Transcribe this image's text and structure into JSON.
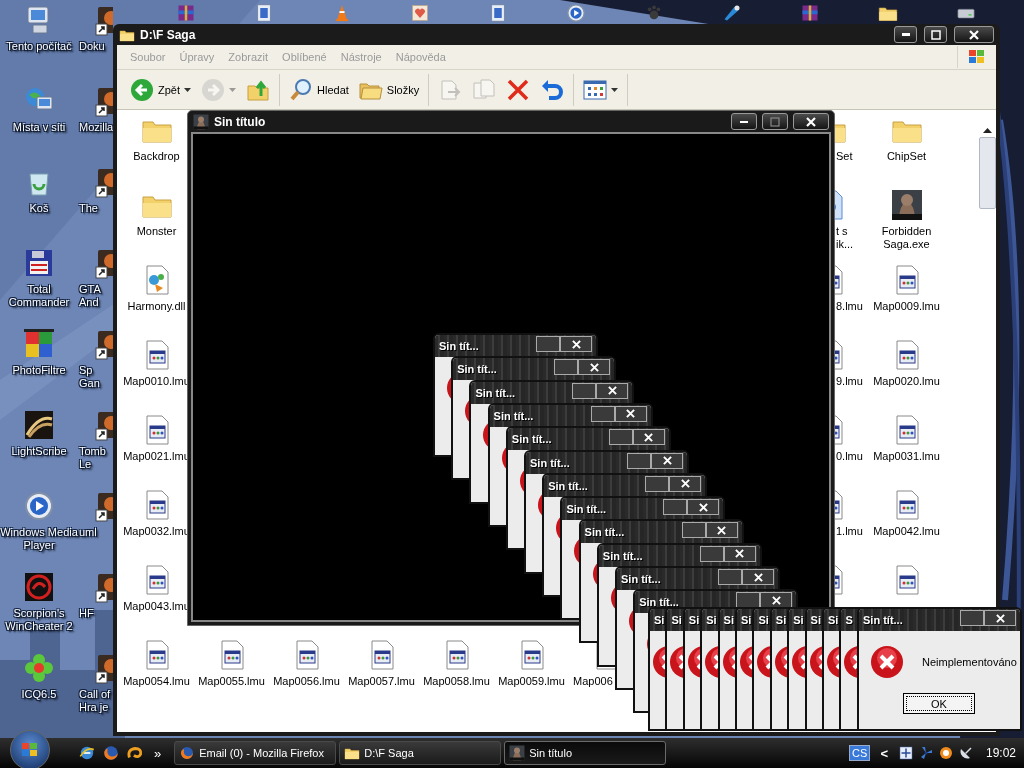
{
  "desktop_icons": [
    {
      "kind": "computer",
      "lines": [
        "Tento počítač"
      ]
    },
    {
      "kind": "network",
      "lines": [
        "Místa v síti"
      ]
    },
    {
      "kind": "trash",
      "lines": [
        "Koš"
      ]
    },
    {
      "kind": "floppy",
      "lines": [
        "Total",
        "Commander"
      ]
    },
    {
      "kind": "palette",
      "lines": [
        "PhotoFiltre"
      ]
    },
    {
      "kind": "disc",
      "lines": [
        "LightScribe"
      ]
    },
    {
      "kind": "media",
      "lines": [
        "Windows Media",
        "Player"
      ]
    },
    {
      "kind": "scorpion",
      "lines": [
        "Scorpion's",
        "WinCheater 2"
      ]
    },
    {
      "kind": "flower",
      "lines": [
        "ICQ6.5"
      ]
    }
  ],
  "desktop_icons_2": [
    {
      "kind": "app",
      "lines": [
        "Doku"
      ]
    },
    {
      "kind": "app",
      "lines": [
        "Mozilla"
      ]
    },
    {
      "kind": "app",
      "lines": [
        "The"
      ]
    },
    {
      "kind": "app",
      "lines": [
        "GTA",
        "And"
      ]
    },
    {
      "kind": "app",
      "lines": [
        "Sp",
        "Gan"
      ]
    },
    {
      "kind": "app",
      "lines": [
        "Tomb",
        "Le"
      ]
    },
    {
      "kind": "app",
      "lines": [
        "uml"
      ]
    },
    {
      "kind": "app",
      "lines": [
        "HF"
      ]
    },
    {
      "kind": "app",
      "lines": [
        "Call of",
        "Hra je"
      ]
    }
  ],
  "top_icons": [
    {
      "kind": "archive"
    },
    {
      "kind": "film"
    },
    {
      "kind": "cone"
    },
    {
      "kind": "heart"
    },
    {
      "kind": "film"
    },
    {
      "kind": "media"
    },
    {
      "kind": "paw"
    },
    {
      "kind": "paint"
    },
    {
      "kind": "archive"
    },
    {
      "kind": "folder"
    },
    {
      "kind": "drive"
    }
  ],
  "explorer": {
    "title": "D:\\F Saga",
    "menu": [
      "Soubor",
      "Úpravy",
      "Zobrazit",
      "Oblíbené",
      "Nástroje",
      "Nápověda"
    ],
    "toolbar": [
      [
        {
          "kind": "back",
          "label": "Zpět",
          "disabled": false,
          "dropdown": true
        },
        {
          "kind": "forward",
          "disabled": true,
          "dropdown": true
        },
        {
          "kind": "up",
          "disabled": false,
          "dropdown": false
        }
      ],
      [
        {
          "kind": "search",
          "label": "Hledat",
          "disabled": false,
          "dropdown": false
        },
        {
          "kind": "folders",
          "label": "Složky",
          "disabled": false,
          "dropdown": false
        }
      ],
      [
        {
          "kind": "move",
          "disabled": true,
          "dropdown": false
        },
        {
          "kind": "copy",
          "disabled": true,
          "dropdown": false
        },
        {
          "kind": "delete",
          "disabled": false,
          "dropdown": false
        },
        {
          "kind": "undo",
          "disabled": false,
          "dropdown": false
        }
      ],
      [
        {
          "kind": "views",
          "disabled": false,
          "dropdown": true
        }
      ]
    ],
    "files": {
      "left_column": [
        {
          "kind": "folder",
          "lines": [
            "Backdrop"
          ]
        },
        {
          "kind": "folder",
          "lines": [
            "Monster"
          ]
        },
        {
          "kind": "dll",
          "lines": [
            "Harmony.dll"
          ]
        },
        {
          "kind": "map",
          "lines": [
            "Map0010.lmu"
          ]
        },
        {
          "kind": "map",
          "lines": [
            "Map0021.lmu"
          ]
        },
        {
          "kind": "map",
          "lines": [
            "Map0032.lmu"
          ]
        },
        {
          "kind": "map",
          "lines": [
            "Map0043.lmu"
          ]
        }
      ],
      "bottom_row": [
        {
          "kind": "map",
          "lines": [
            "Map0054.lmu"
          ]
        },
        {
          "kind": "map",
          "lines": [
            "Map0055.lmu"
          ]
        },
        {
          "kind": "map",
          "lines": [
            "Map0056.lmu"
          ]
        },
        {
          "kind": "map",
          "lines": [
            "Map0057.lmu"
          ]
        },
        {
          "kind": "map",
          "lines": [
            "Map0058.lmu"
          ]
        },
        {
          "kind": "map",
          "lines": [
            "Map0059.lmu"
          ]
        },
        {
          "kind": "map",
          "lines": [
            "Map006"
          ]
        }
      ],
      "partial_column": [
        {
          "kind": "folder",
          "lines": [
            "Set"
          ]
        },
        {
          "kind": "shortcut",
          "lines": [
            "t s",
            "ik..."
          ]
        },
        {
          "kind": "map",
          "lines": [
            "8.lmu"
          ]
        },
        {
          "kind": "map",
          "lines": [
            "9.lmu"
          ]
        },
        {
          "kind": "map",
          "lines": [
            "0.lmu"
          ]
        },
        {
          "kind": "map",
          "lines": [
            "1.lmu"
          ]
        },
        {
          "kind": "map"
        }
      ],
      "right_column": [
        {
          "kind": "folder",
          "lines": [
            "ChipSet"
          ]
        },
        {
          "kind": "exe",
          "lines": [
            "Forbidden",
            "Saga.exe"
          ]
        },
        {
          "kind": "map",
          "lines": [
            "Map0009.lmu"
          ]
        },
        {
          "kind": "map",
          "lines": [
            "Map0020.lmu"
          ]
        },
        {
          "kind": "map",
          "lines": [
            "Map0031.lmu"
          ]
        },
        {
          "kind": "map",
          "lines": [
            "Map0042.lmu"
          ]
        },
        {
          "kind": "map"
        }
      ]
    }
  },
  "game_window": {
    "title": "Sin título"
  },
  "dialogs": {
    "cascade": [
      {
        "title": "Sin tít..."
      },
      {
        "title": "Sin tít..."
      },
      {
        "title": "Sin tít..."
      },
      {
        "title": "Sin tít..."
      },
      {
        "title": "Sin tít..."
      },
      {
        "title": "Sin tít..."
      },
      {
        "title": "Sin tít..."
      },
      {
        "title": "Sin tít..."
      },
      {
        "title": "Sin tít..."
      },
      {
        "title": "Sin tít..."
      },
      {
        "title": "Sin tít..."
      },
      {
        "title": "Sin tít..."
      }
    ],
    "row": [
      {
        "title": "Si"
      },
      {
        "title": "Si"
      },
      {
        "title": "Si"
      },
      {
        "title": "Si"
      },
      {
        "title": "Si"
      },
      {
        "title": "Si"
      },
      {
        "title": "Si"
      },
      {
        "title": "Si"
      },
      {
        "title": "Si"
      },
      {
        "title": "Si"
      },
      {
        "title": "Si"
      },
      {
        "title": "S"
      }
    ],
    "front": {
      "title": "Sin tít...",
      "message": "Neimplementováno",
      "button": "OK"
    }
  },
  "taskbar": {
    "quick_launch": [
      {
        "kind": "ie"
      },
      {
        "kind": "firefox"
      },
      {
        "kind": "swirl"
      }
    ],
    "more": "»",
    "tasks": [
      {
        "kind": "firefox",
        "label": "Email (0) - Mozilla Firefox",
        "selected": false
      },
      {
        "kind": "folder",
        "label": "D:\\F Saga",
        "selected": false
      },
      {
        "kind": "game",
        "label": "Sin título",
        "selected": true
      }
    ],
    "tray_label": "CS",
    "tray_expand": "<",
    "tray_icons": [
      {
        "kind": "move"
      },
      {
        "kind": "fan"
      },
      {
        "kind": "ring"
      },
      {
        "kind": "dish"
      }
    ],
    "clock": "19:02"
  }
}
